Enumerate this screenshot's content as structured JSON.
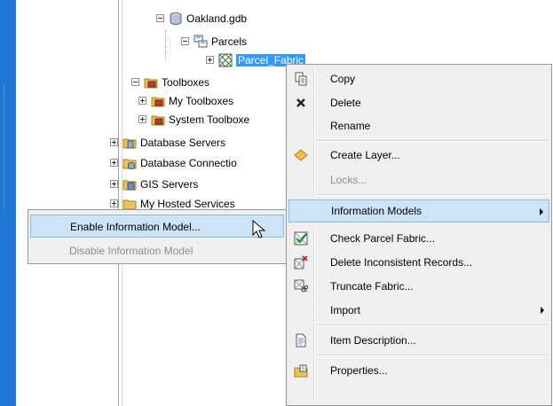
{
  "tree": {
    "nodes": [
      {
        "label": "Oakland.gdb"
      },
      {
        "label": "Parcels"
      },
      {
        "label": "Parcel_Fabric"
      },
      {
        "label": "Toolboxes"
      },
      {
        "label": "My Toolboxes"
      },
      {
        "label": "System Toolboxe"
      },
      {
        "label": "Database Servers"
      },
      {
        "label": "Database Connectio"
      },
      {
        "label": "GIS Servers"
      },
      {
        "label": "My Hosted Services"
      }
    ]
  },
  "context_menu": {
    "items": [
      {
        "label": "Copy",
        "icon": "copy-icon"
      },
      {
        "label": "Delete",
        "icon": "delete-x-icon"
      },
      {
        "label": "Rename"
      },
      {
        "label": "Create Layer...",
        "icon": "layer-diamond-icon"
      },
      {
        "label": "Locks...",
        "disabled": true
      },
      {
        "label": "Information Models",
        "submenu": true,
        "highlighted": true
      },
      {
        "label": "Check Parcel Fabric...",
        "icon": "check-fabric-icon"
      },
      {
        "label": "Delete Inconsistent Records...",
        "icon": "delete-records-icon"
      },
      {
        "label": "Truncate Fabric...",
        "icon": "truncate-icon"
      },
      {
        "label": "Import",
        "submenu": true
      },
      {
        "label": "Item Description...",
        "icon": "document-icon"
      },
      {
        "label": "Properties...",
        "icon": "properties-icon"
      }
    ]
  },
  "submenu": {
    "items": [
      {
        "label": "Enable Information Model...",
        "highlighted": true
      },
      {
        "label": "Disable Information Model",
        "disabled": true
      }
    ]
  },
  "colors": {
    "desktop": "#1e78d6",
    "selection": "#3399ff",
    "menu_background": "#f0f0f0",
    "menu_highlight": "#cde4f7"
  }
}
